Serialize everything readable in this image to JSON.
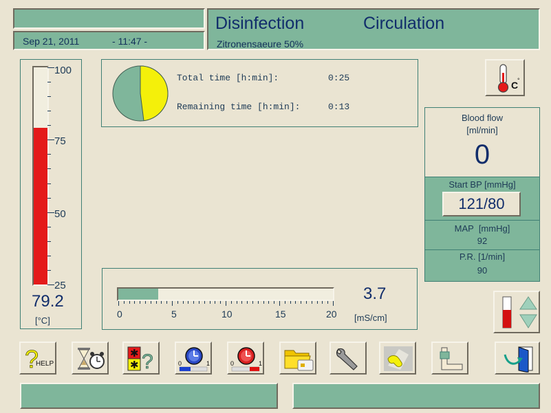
{
  "header": {
    "top_left_field": "",
    "date": "Sep 21, 2011",
    "time": "- 11:47 -",
    "mode": "Disinfection",
    "state": "Circulation",
    "agent": "Zitronensaeure 50%"
  },
  "thermometer": {
    "scale_labels": [
      "100",
      "75",
      "50",
      "25"
    ],
    "range": [
      25,
      100
    ],
    "fill_value": 79.2,
    "value": "79.2",
    "unit": "[°C]",
    "fill_color": "#e41a1a"
  },
  "timer": {
    "total_label": "Total time [h:min]:",
    "total_value": "0:25",
    "remaining_label": "Remaining time [h:min]:",
    "remaining_value": "0:13",
    "elapsed_fraction": 0.48
  },
  "conductivity": {
    "scale_labels": [
      "0",
      "5",
      "10",
      "15",
      "20"
    ],
    "range": [
      0,
      20
    ],
    "value_num": 3.7,
    "value": "3.7",
    "unit": "[mS/cm]"
  },
  "vitals": {
    "blood_flow_label": "Blood flow",
    "blood_flow_unit": "[ml/min]",
    "blood_flow_value": "0",
    "start_bp_label": "Start BP [mmHg]",
    "start_bp_value": "121/80",
    "map_label": "MAP  [mmHg]",
    "map_value": "92",
    "pr_label": "P.R. [1/min]",
    "pr_value": "90"
  },
  "temp_button_unit": "C",
  "toolbar": {
    "help_label": "HELP",
    "icons": [
      "help-icon",
      "hourglass-alarm-icon",
      "alarm-question-icon",
      "timer-off-icon",
      "timer-on-icon",
      "folder-card-icon",
      "wrench-icon",
      "cleaning-cloth-icon",
      "arm-cuff-icon",
      "exit-door-icon"
    ]
  },
  "status": {
    "left": "",
    "right": ""
  },
  "colors": {
    "accent_green": "#7fb69b",
    "background": "#eae4d2",
    "text_navy": "#112d6b",
    "pie_yellow": "#f4f00a"
  }
}
